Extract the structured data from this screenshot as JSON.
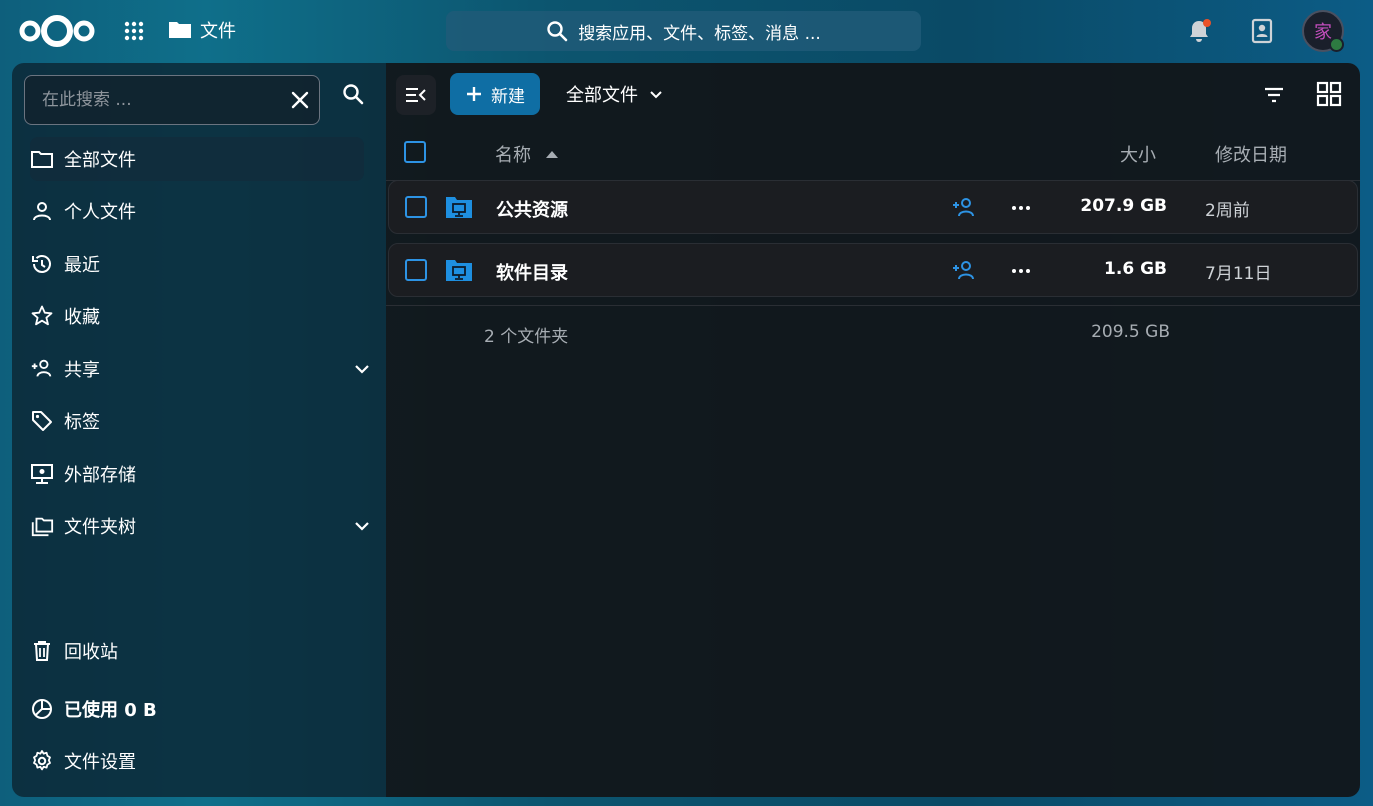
{
  "header": {
    "app_name": "文件",
    "search_placeholder": "搜索应用、文件、标签、消息 ...",
    "avatar_text": "家",
    "colors": {
      "accent": "#0f6ea4",
      "notification_dot": "#e9532a",
      "status_online": "#2d7b41",
      "avatar_text": "#c24dbd"
    },
    "icons": [
      "nextcloud-logo",
      "apps-grid-icon",
      "folder-icon",
      "search-icon",
      "bell-icon",
      "contacts-icon"
    ]
  },
  "sidebar": {
    "search_placeholder": "在此搜索 ...",
    "items": [
      {
        "label": "全部文件",
        "icon": "folder-icon",
        "active": true
      },
      {
        "label": "个人文件",
        "icon": "user-icon"
      },
      {
        "label": "最近",
        "icon": "history-icon"
      },
      {
        "label": "收藏",
        "icon": "star-icon"
      },
      {
        "label": "共享",
        "icon": "share-icon",
        "expandable": true
      },
      {
        "label": "标签",
        "icon": "tag-icon"
      },
      {
        "label": "外部存储",
        "icon": "external-storage-icon"
      },
      {
        "label": "文件夹树",
        "icon": "folder-tree-icon",
        "expandable": true
      }
    ],
    "footer": [
      {
        "label": "回收站",
        "icon": "trash-icon"
      },
      {
        "label": "已使用 0 B",
        "icon": "pie-chart-icon"
      },
      {
        "label": "文件设置",
        "icon": "gear-icon"
      }
    ]
  },
  "toolbar": {
    "new_label": "新建",
    "breadcrumb": "全部文件"
  },
  "table": {
    "headers": {
      "name": "名称",
      "size": "大小",
      "modified": "修改日期"
    },
    "rows": [
      {
        "name": "公共资源",
        "size": "207.9 GB",
        "modified": "2周前"
      },
      {
        "name": "软件目录",
        "size": "1.6 GB",
        "modified": "7月11日"
      }
    ],
    "summary": {
      "count": "2 个文件夹",
      "total": "209.5 GB"
    }
  }
}
